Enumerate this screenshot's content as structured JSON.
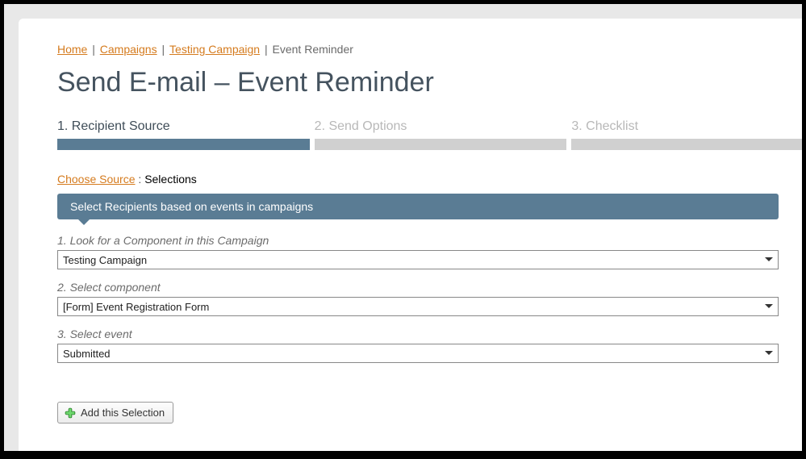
{
  "breadcrumb": {
    "home": "Home",
    "campaigns": "Campaigns",
    "campaign_name": "Testing Campaign",
    "current": "Event Reminder"
  },
  "page_title": "Send E-mail – Event Reminder",
  "steps": [
    {
      "label": "1. Recipient Source",
      "active": true
    },
    {
      "label": "2. Send Options",
      "active": false
    },
    {
      "label": "3. Checklist",
      "active": false
    }
  ],
  "sub_nav": {
    "choose_source": "Choose Source",
    "selections": "Selections"
  },
  "banner": "Select Recipients based on events in campaigns",
  "fields": {
    "campaign": {
      "label": "1. Look for a Component in this Campaign",
      "value": "Testing Campaign"
    },
    "component": {
      "label": "2. Select component",
      "value": "[Form] Event Registration Form"
    },
    "event": {
      "label": "3. Select event",
      "value": "Submitted"
    }
  },
  "add_button": "Add this Selection"
}
